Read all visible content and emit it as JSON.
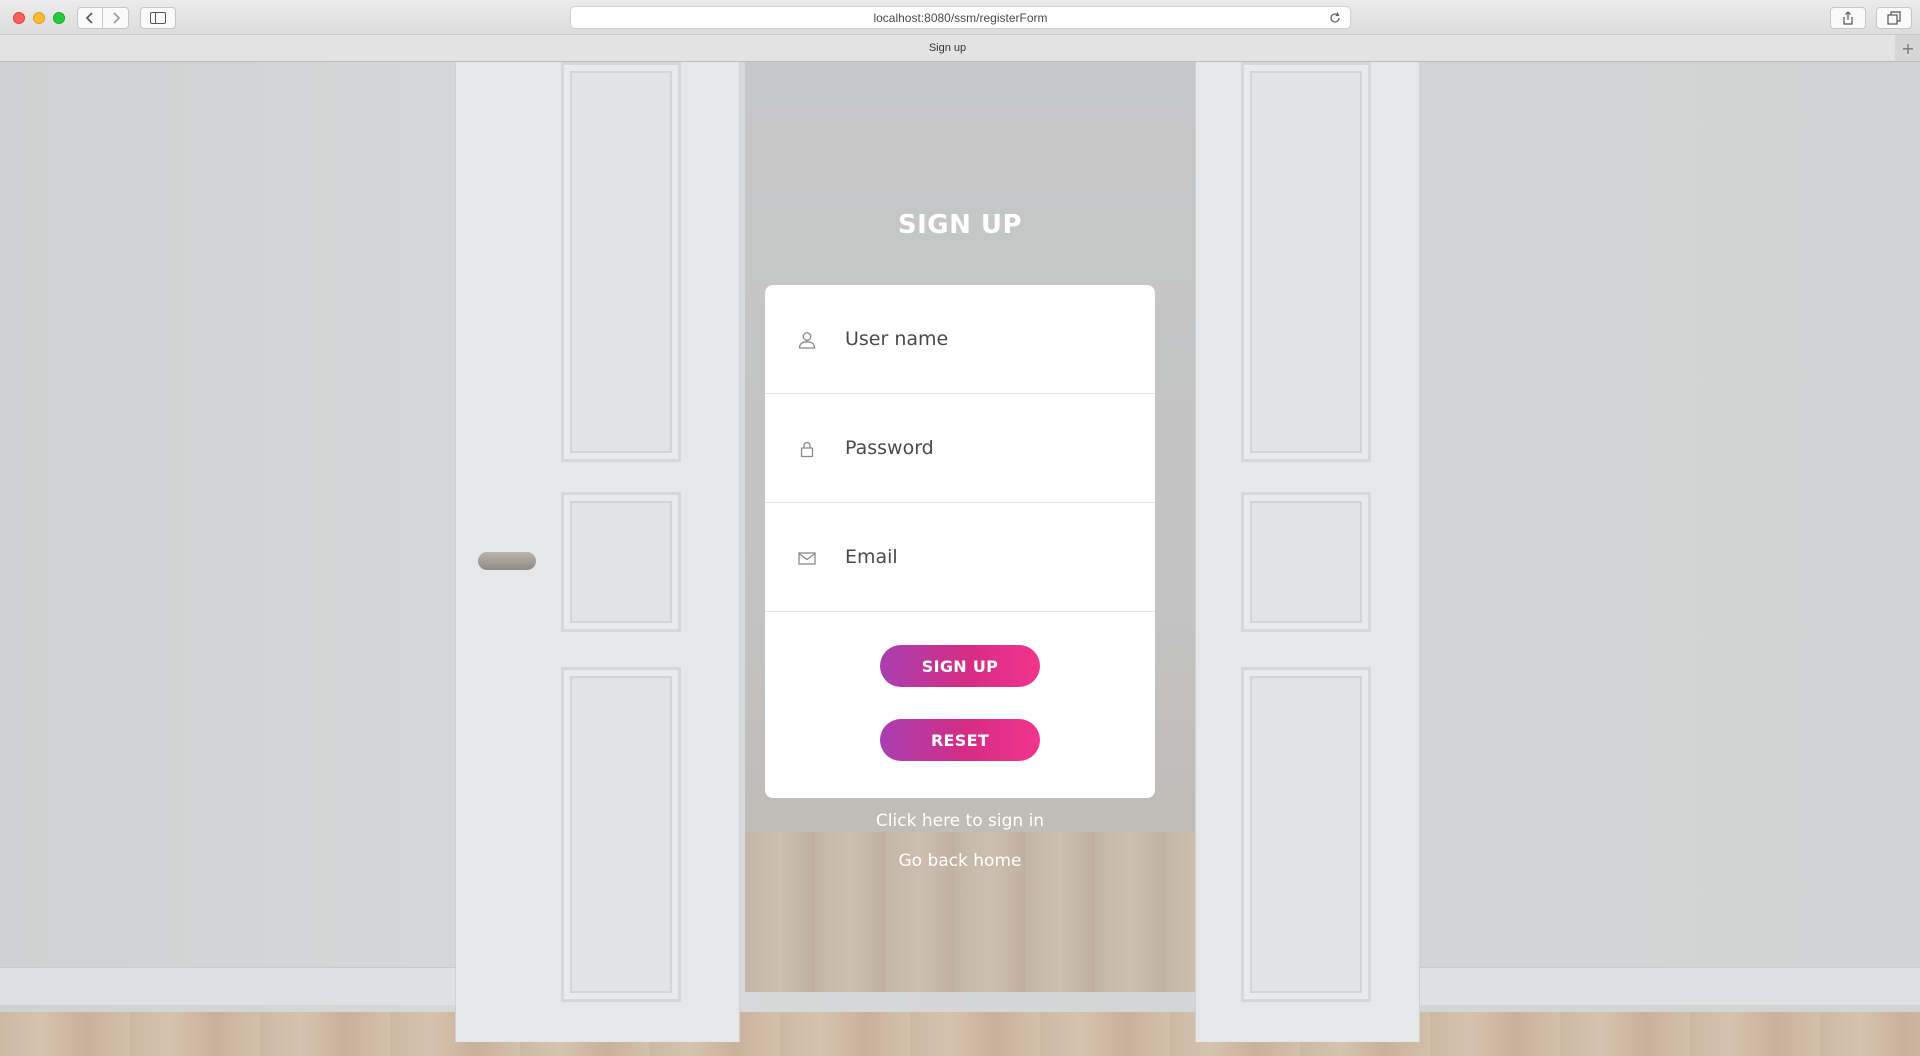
{
  "browser": {
    "url": "localhost:8080/ssm/registerForm",
    "tab_title": "Sign up",
    "new_tab_label": "+"
  },
  "page": {
    "title": "SIGN UP",
    "form": {
      "username_placeholder": "User name",
      "password_placeholder": "Password",
      "email_placeholder": "Email",
      "signup_label": "SIGN UP",
      "reset_label": "RESET"
    },
    "links": {
      "signin": "Click here to sign in",
      "home": "Go back home"
    }
  },
  "colors": {
    "button_gradient_start": "#a83fb0",
    "button_gradient_end": "#f2358f",
    "card_background": "#ffffff",
    "text_light": "#ffffff"
  },
  "icons": [
    "user-icon",
    "lock-icon",
    "mail-icon",
    "reload-icon",
    "share-icon",
    "tabs-icon",
    "sidebar-icon",
    "back-icon",
    "forward-icon"
  ]
}
